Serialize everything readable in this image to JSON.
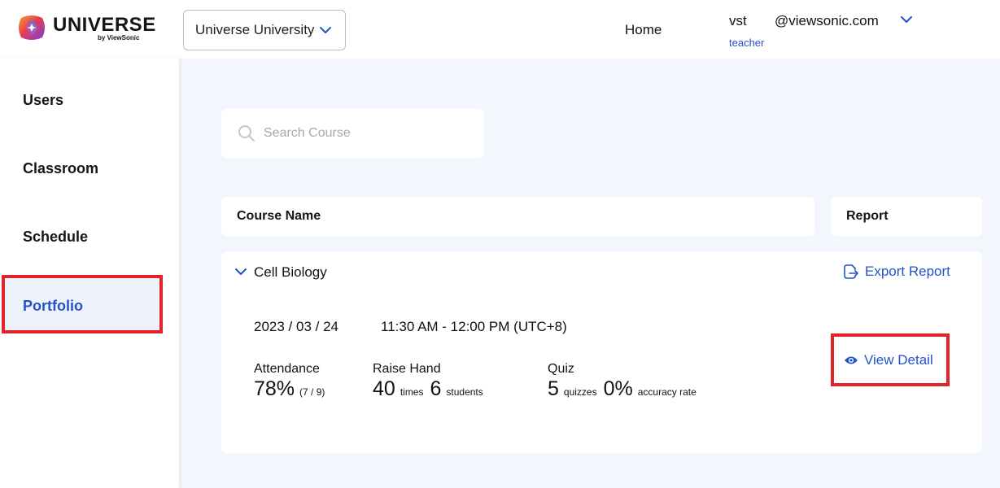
{
  "brand": {
    "name": "UNIVERSE",
    "sub": "by ViewSonic"
  },
  "header": {
    "org_select": "Universe University",
    "nav_home": "Home",
    "user": {
      "name": "vst",
      "email": "@viewsonic.com",
      "role": "teacher"
    }
  },
  "sidebar": {
    "items": [
      {
        "label": "Users"
      },
      {
        "label": "Classroom"
      },
      {
        "label": "Schedule"
      },
      {
        "label": "Portfolio",
        "active": true
      }
    ]
  },
  "search": {
    "placeholder": "Search Course",
    "value": ""
  },
  "table": {
    "headers": {
      "course": "Course Name",
      "report": "Report"
    }
  },
  "course": {
    "name": "Cell Biology",
    "export_label": "Export Report",
    "date": "2023 / 03 / 24",
    "time": "11:30 AM - 12:00 PM (UTC+8)",
    "attendance": {
      "label": "Attendance",
      "value": "78%",
      "detail": "(7 / 9)"
    },
    "raise_hand": {
      "label": "Raise Hand",
      "times": "40",
      "times_unit": "times",
      "students": "6",
      "students_unit": "students"
    },
    "quiz": {
      "label": "Quiz",
      "count": "5",
      "count_unit": "quizzes",
      "accuracy": "0%",
      "accuracy_unit": "accuracy rate"
    },
    "view_detail": "View Detail"
  },
  "colors": {
    "accent": "#2453c9",
    "highlight": "#e3232c",
    "background": "#f3f6fd"
  },
  "icons": [
    "chevron-down-icon",
    "search-icon",
    "export-icon",
    "eye-icon",
    "universe-logo-icon"
  ]
}
